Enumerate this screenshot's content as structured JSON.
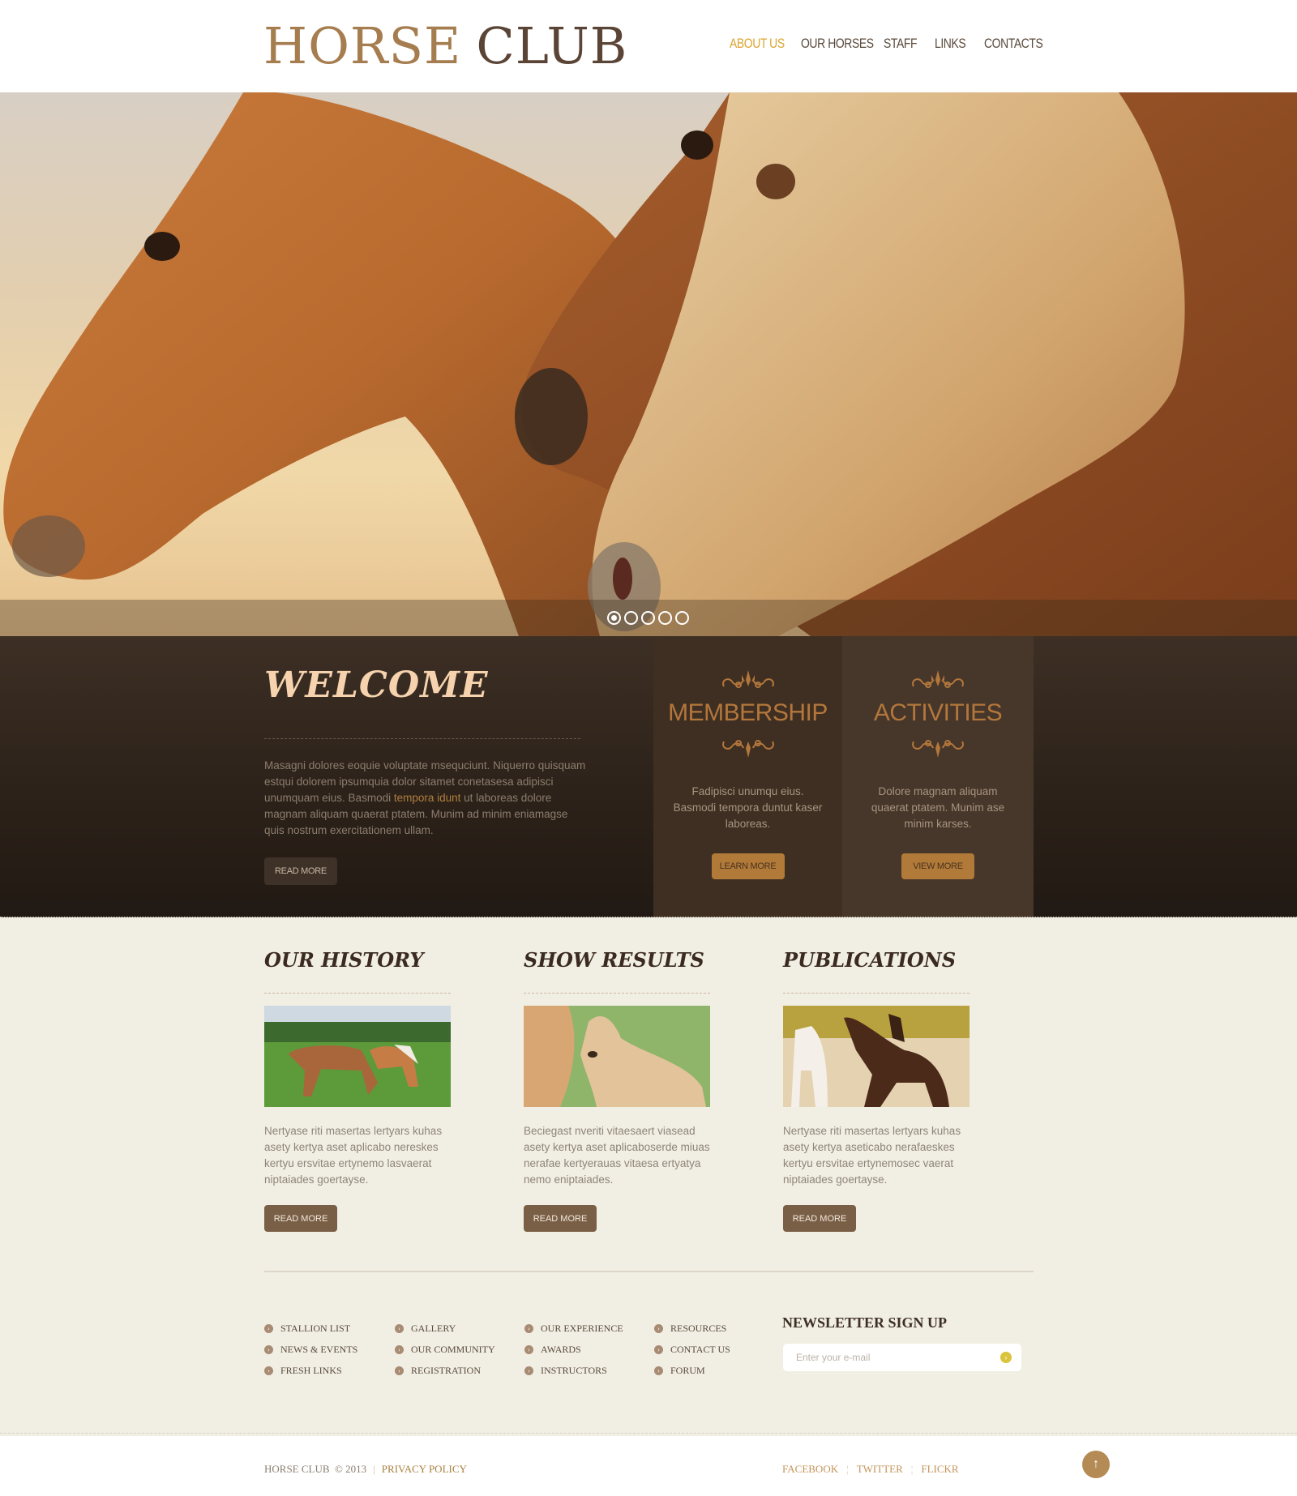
{
  "header": {
    "logo_word1": "HORSE",
    "logo_word2": "CLUB",
    "nav": [
      {
        "label": "ABOUT US",
        "active": true
      },
      {
        "label": "OUR HORSES",
        "active": false
      },
      {
        "label": "STAFF",
        "active": false
      },
      {
        "label": "LINKS",
        "active": false
      },
      {
        "label": "CONTACTS",
        "active": false
      }
    ]
  },
  "hero": {
    "image": "two-horses-heads-photo",
    "slides_total": 5,
    "active_slide": 1
  },
  "welcome": {
    "title": "WELCOME",
    "text_before": "Masagni dolores eoquie voluptate msequciunt. Niquerro quisquam estqui dolorem ipsumquia dolor sitamet conetasesa adipisci unumquam eius. Basmodi ",
    "text_highlight": "tempora idunt",
    "text_after": " ut laboreas dolore magnam aliquam quaerat ptatem. Munim ad minim eniamagse quis nostrum exercitationem ullam.",
    "button": "READ MORE"
  },
  "membership": {
    "title": "MEMBERSHIP",
    "text": "Fadipisci unumqu eius. Basmodi tempora duntut kaser laboreas.",
    "button": "LEARN MORE"
  },
  "activities": {
    "title": "ACTIVITIES",
    "text": "Dolore magnam aliquam quaerat ptatem. Munim ase minim karses.",
    "button": "VIEW MORE"
  },
  "sections": [
    {
      "title": "OUR HISTORY",
      "image": "horses-grazing-photo",
      "text": "Nertyase riti masertas lertyars kuhas asety kertya aset aplicabo nereskes kertyu ersvitae ertynemo lasvaerat niptaiades goertayse.",
      "button": "READ MORE"
    },
    {
      "title": "SHOW RESULTS",
      "image": "mare-and-foal-photo",
      "text": "Beciegast nveriti vitaesaert viasead asety kertya aset aplicaboserde miuas nerafae kertyerauas vitaesa ertyatya nemo eniptaiades.",
      "button": "READ MORE"
    },
    {
      "title": "PUBLICATIONS",
      "image": "running-horses-photo",
      "text": "Nertyase riti masertas lertyars kuhas asety kertya aseticabo nerafaeskes kertyu ersvitae ertynemosec vaerat niptaiades goertayse.",
      "button": "READ MORE"
    }
  ],
  "links": [
    [
      "STALLION LIST",
      "NEWS & EVENTS",
      "FRESH LINKS"
    ],
    [
      "GALLERY",
      "OUR COMMUNITY",
      "REGISTRATION"
    ],
    [
      "OUR EXPERIENCE",
      "AWARDS",
      "INSTRUCTORS"
    ],
    [
      "RESOURCES",
      "CONTACT US",
      "FORUM"
    ]
  ],
  "newsletter": {
    "title": "NEWSLETTER SIGN UP",
    "placeholder": "Enter your e-mail",
    "value": ""
  },
  "footer": {
    "brand": "HORSE CLUB",
    "copyright": "© 2013",
    "separator": "|",
    "privacy": "PRIVACY POLICY",
    "social": [
      "FACEBOOK",
      "TWITTER",
      "FLICKR"
    ]
  },
  "colors": {
    "accent_gold": "#dba532",
    "brown_button": "#7a5f47",
    "orange_button": "#b17a38",
    "dark_band": "#2b2119",
    "cream_bg": "#f1eee4"
  }
}
